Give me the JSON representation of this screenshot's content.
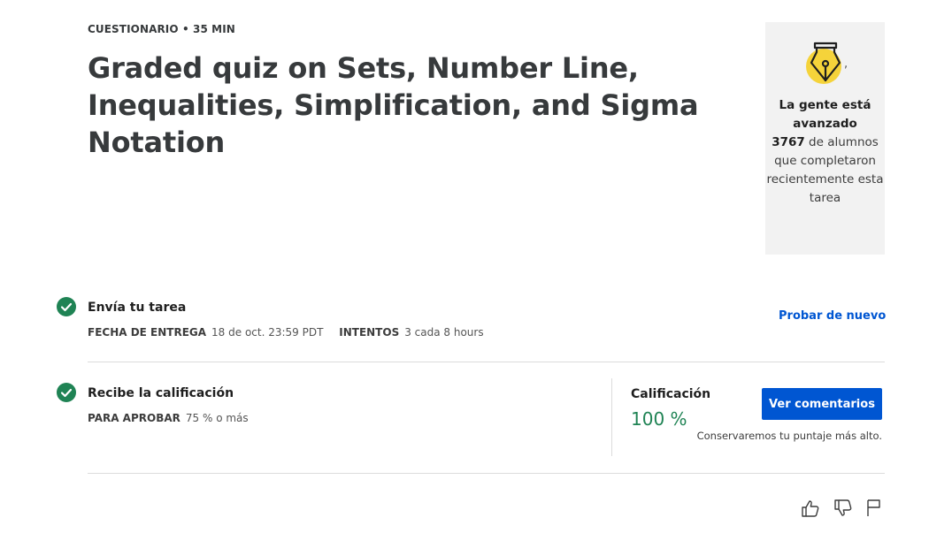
{
  "header": {
    "eyebrow": "CUESTIONARIO • 35 MIN",
    "title": "Graded quiz on Sets, Number Line, Inequalities, Simplification, and Sigma Notation"
  },
  "card": {
    "icon": "pen-nib-icon",
    "comma": ",",
    "line1": "La gente está avanzado",
    "count": "3767",
    "line2": " de alumnos que completaron recientemente esta tarea"
  },
  "submit": {
    "title": "Envía tu tarea",
    "due_label": "FECHA DE ENTREGA",
    "due_value": "18 de oct. 23:59 PDT",
    "attempts_label": "INTENTOS",
    "attempts_value": "3 cada 8 hours",
    "retry_link": "Probar de nuevo"
  },
  "grade": {
    "title": "Recibe la calificación",
    "pass_label": "PARA APROBAR",
    "pass_value": "75 % o más",
    "label": "Calificación",
    "value": "100 %",
    "feedback_button": "Ver comentarios",
    "note": "Conservaremos tu puntaje más alto."
  },
  "feedback": {
    "like_icon": "thumbs-up-icon",
    "dislike_icon": "thumbs-down-icon",
    "report_icon": "flag-icon"
  },
  "colors": {
    "accent": "#0056d2",
    "success": "#1f8354",
    "badge_yellow": "#f5d33a"
  }
}
